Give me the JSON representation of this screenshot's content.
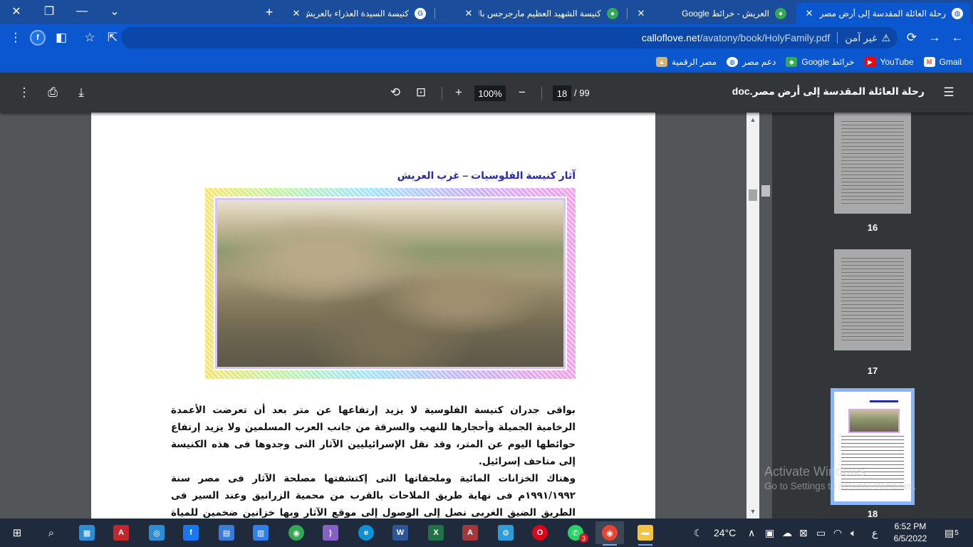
{
  "browser": {
    "tabs": [
      {
        "title": "رحلة العائلة المقدسة إلى أرض مصر",
        "active": true,
        "favicon": "globe-icon"
      },
      {
        "title": "العريش - خرائط Google",
        "active": false,
        "favicon": "maps-pin-icon"
      },
      {
        "title": "كنيسة الشهيد العظيم مارجرجس بالع",
        "active": false,
        "favicon": "maps-pin-icon"
      },
      {
        "title": "كنيسة السيدة العذراء بالعريش - بحث",
        "active": false,
        "favicon": "google-icon"
      }
    ],
    "new_tab_label": "+",
    "omnibox": {
      "security_label": "غير آمن",
      "url_host": "calloflove.net",
      "url_path": "/avatony/book/HolyFamily.pdf"
    },
    "profile_initial": "f",
    "bookmarks": [
      {
        "label": "Gmail",
        "icon": "gmail-icon",
        "color": "#ea4335"
      },
      {
        "label": "YouTube",
        "icon": "youtube-icon",
        "color": "#ff0000"
      },
      {
        "label": "خرائط Google",
        "icon": "maps-icon",
        "color": "#34a853"
      },
      {
        "label": "دعم مصر",
        "icon": "globe-icon",
        "color": "#ffffff"
      },
      {
        "label": "مصر الرقمية",
        "icon": "digital-egypt-icon",
        "color": "#d4b27a"
      }
    ]
  },
  "pdf_viewer": {
    "document_title": "رحلة العائلة المقدسة إلى أرض مصر.doc",
    "current_page": "18",
    "page_total": "/ 99",
    "zoom": "100%",
    "page": {
      "heading": "آثار كنيسة الفلوسيات – غرب العريش",
      "paragraphs": [
        "بواقى جدران كنيسة الفلوسية لا يزيد إرتفاعها عن متر بعد أن تعرضت الأعمدة الرخامية الجميلة وأحجارها للنهب والسرقة من جانب العرب المسلمين ولا يزيد إرتفاع حوائطها اليوم عن المتر، وقد نقل الإسرائيليين الآثار التى وجدوها فى هذه الكنيسة إلى متاحف إسرائيل.",
        "وهناك الخزانات المائية وملحقاتها التى إكتشفتها مصلحة الآثار فى مصر سنة ١٩٩١/١٩٩٢م فى نهاية طريق الملاحات بالقرب من محمية الزرانيق وعند السير فى الطريق الضيق الغربى نصل إلى الوصول إلى موقع الآثار وبها خزانين ضخمين للمياة بأكتاف حجرية لحمايته ويتوسطها سلالم وقد"
      ]
    },
    "thumbnails": [
      {
        "page": "16",
        "current": false
      },
      {
        "page": "17",
        "current": false
      },
      {
        "page": "18",
        "current": true
      }
    ]
  },
  "watermark": {
    "line1": "Activate Windows",
    "line2": "Go to Settings to activate Windows."
  },
  "taskbar": {
    "apps": [
      {
        "name": "file-explorer-icon",
        "color": "#f5c242"
      },
      {
        "name": "access-icon",
        "color": "#a4373a",
        "label": "A"
      },
      {
        "name": "search-app-icon",
        "color": "#2b8cd8"
      },
      {
        "name": "facebook-icon",
        "color": "#1877f2",
        "label": "f"
      },
      {
        "name": "calculator-icon",
        "color": "#3a7bd5"
      },
      {
        "name": "calendar-icon",
        "color": "#2f80ed"
      },
      {
        "name": "chrome-icon",
        "color": "#34a853"
      },
      {
        "name": "visual-studio-icon",
        "color": "#8661c5"
      },
      {
        "name": "edge-icon",
        "color": "#0f8fd8"
      },
      {
        "name": "word-icon",
        "color": "#2b579a",
        "label": "W"
      },
      {
        "name": "excel-icon",
        "color": "#217346",
        "label": "X"
      },
      {
        "name": "access-db-icon",
        "color": "#a4373a",
        "label": "A"
      },
      {
        "name": "settings-app-icon",
        "color": "#2d9cdb"
      },
      {
        "name": "opera-icon",
        "color": "#e0001a",
        "label": "O"
      },
      {
        "name": "whatsapp-icon",
        "color": "#25d366",
        "badge": "3"
      },
      {
        "name": "chrome-maps-icon",
        "color": "#ea4335"
      },
      {
        "name": "folder-icon",
        "color": "#f5c242"
      }
    ],
    "weather": "24°C",
    "language": "ع",
    "time": "6:52 PM",
    "date": "6/5/2022",
    "notification_count": "5"
  }
}
